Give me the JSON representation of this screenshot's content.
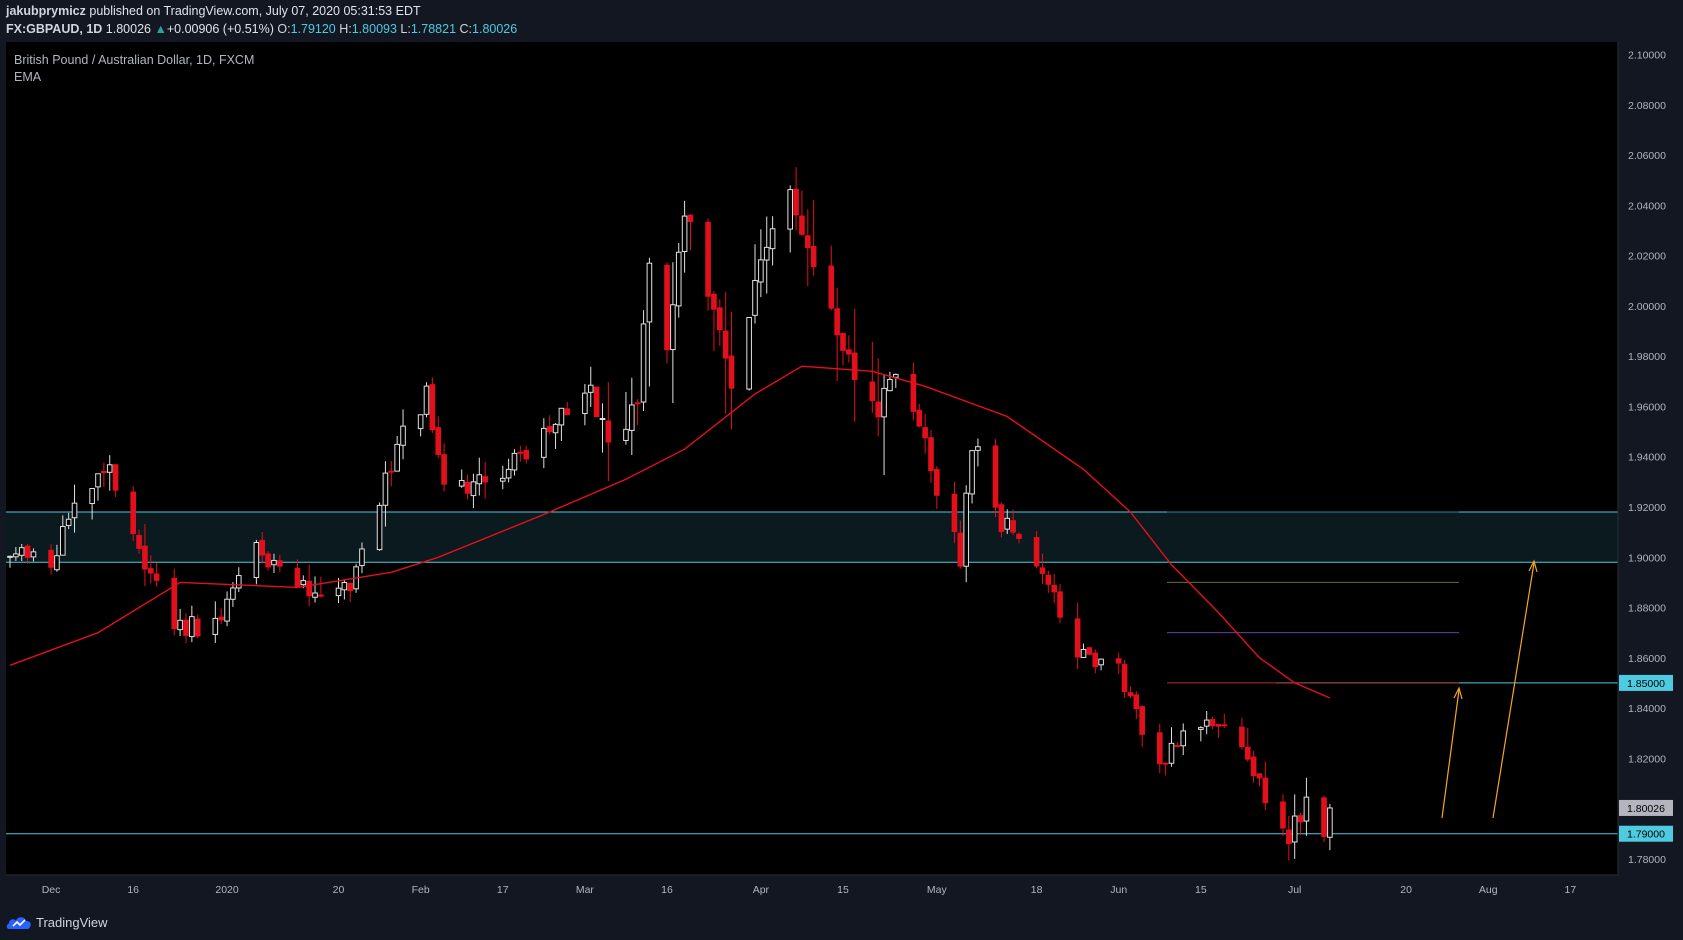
{
  "header": {
    "author": "jakubprymicz",
    "published_text": "published on TradingView.com, July 07, 2020 05:31:53 EDT",
    "symbol": "FX:GBPAUD, 1D",
    "last_price": "1.80026",
    "change": "+0.00906 (+0.51%)",
    "open_label": "O:",
    "open": "1.79120",
    "high_label": "H:",
    "high": "1.80093",
    "low_label": "L:",
    "low": "1.78821",
    "close_label": "C:",
    "close": "1.80026"
  },
  "legend": {
    "title": "British Pound / Australian Dollar, 1D, FXCM",
    "indicator": "EMA"
  },
  "footer": {
    "logo_text": "TradingView"
  },
  "colors": {
    "background": "#000000",
    "up_candle": "#e0e0e0",
    "down_candle": "#e3101c",
    "ema": "#e3101c",
    "support_line": "#4ecbe0",
    "zone_fill": "#0a1a1e",
    "arrow": "#f5a623",
    "level_olive": "#6b6b2a",
    "level_purple": "#6a3fa0",
    "level_red": "#b0302a",
    "current_price_tag": "#b2b5be"
  },
  "chart_data": {
    "type": "candlestick",
    "title": "British Pound / Australian Dollar, 1D, FXCM",
    "symbol": "FX:GBPAUD",
    "interval": "1D",
    "x_start": "2019-11-25",
    "x_end": "2020-08-20",
    "last_bar_date": "2020-07-07",
    "ylim": [
      1.77,
      2.105
    ],
    "y_ticks": [
      "2.10000",
      "2.08000",
      "2.06000",
      "2.04000",
      "2.02000",
      "2.00000",
      "1.98000",
      "1.96000",
      "1.94000",
      "1.92000",
      "1.90000",
      "1.88000",
      "1.86000",
      "1.84000",
      "1.82000",
      "1.80000",
      "1.78000"
    ],
    "x_ticks": [
      {
        "label": "Dec",
        "date": "2019-12-02"
      },
      {
        "label": "16",
        "date": "2019-12-16"
      },
      {
        "label": "2020",
        "date": "2020-01-01"
      },
      {
        "label": "20",
        "date": "2020-01-20"
      },
      {
        "label": "Feb",
        "date": "2020-02-03"
      },
      {
        "label": "17",
        "date": "2020-02-17"
      },
      {
        "label": "Mar",
        "date": "2020-03-02"
      },
      {
        "label": "16",
        "date": "2020-03-16"
      },
      {
        "label": "Apr",
        "date": "2020-04-01"
      },
      {
        "label": "15",
        "date": "2020-04-15"
      },
      {
        "label": "May",
        "date": "2020-05-01"
      },
      {
        "label": "18",
        "date": "2020-05-18"
      },
      {
        "label": "Jun",
        "date": "2020-06-01"
      },
      {
        "label": "15",
        "date": "2020-06-15"
      },
      {
        "label": "Jul",
        "date": "2020-07-01"
      },
      {
        "label": "20",
        "date": "2020-07-20"
      },
      {
        "label": "Aug",
        "date": "2020-08-03"
      },
      {
        "label": "17",
        "date": "2020-08-17"
      }
    ],
    "price_path": [
      {
        "date": "2019-11-25",
        "price": 1.901
      },
      {
        "date": "2019-12-03",
        "price": 1.902
      },
      {
        "date": "2019-12-10",
        "price": 1.935
      },
      {
        "date": "2019-12-13",
        "price": 1.93
      },
      {
        "date": "2019-12-17",
        "price": 1.905
      },
      {
        "date": "2019-12-24",
        "price": 1.871
      },
      {
        "date": "2019-12-31",
        "price": 1.879
      },
      {
        "date": "2020-01-06",
        "price": 1.905
      },
      {
        "date": "2020-01-13",
        "price": 1.885
      },
      {
        "date": "2020-01-22",
        "price": 1.885
      },
      {
        "date": "2020-01-28",
        "price": 1.93
      },
      {
        "date": "2020-02-04",
        "price": 1.968
      },
      {
        "date": "2020-02-07",
        "price": 1.93
      },
      {
        "date": "2020-02-13",
        "price": 1.93
      },
      {
        "date": "2020-02-18",
        "price": 1.935
      },
      {
        "date": "2020-02-26",
        "price": 1.958
      },
      {
        "date": "2020-03-03",
        "price": 1.97
      },
      {
        "date": "2020-03-06",
        "price": 1.94
      },
      {
        "date": "2020-03-11",
        "price": 1.96
      },
      {
        "date": "2020-03-13",
        "price": 2.02
      },
      {
        "date": "2020-03-16",
        "price": 1.982
      },
      {
        "date": "2020-03-19",
        "price": 2.04
      },
      {
        "date": "2020-03-24",
        "price": 2.0
      },
      {
        "date": "2020-03-27",
        "price": 1.965
      },
      {
        "date": "2020-04-01",
        "price": 2.02
      },
      {
        "date": "2020-04-06",
        "price": 2.05
      },
      {
        "date": "2020-04-08",
        "price": 2.03
      },
      {
        "date": "2020-04-15",
        "price": 1.98
      },
      {
        "date": "2020-04-21",
        "price": 1.96
      },
      {
        "date": "2020-04-24",
        "price": 1.975
      },
      {
        "date": "2020-04-30",
        "price": 1.935
      },
      {
        "date": "2020-05-05",
        "price": 1.9
      },
      {
        "date": "2020-05-07",
        "price": 1.945
      },
      {
        "date": "2020-05-13",
        "price": 1.91
      },
      {
        "date": "2020-05-19",
        "price": 1.895
      },
      {
        "date": "2020-05-26",
        "price": 1.86
      },
      {
        "date": "2020-06-01",
        "price": 1.855
      },
      {
        "date": "2020-06-08",
        "price": 1.82
      },
      {
        "date": "2020-06-12",
        "price": 1.83
      },
      {
        "date": "2020-06-16",
        "price": 1.838
      },
      {
        "date": "2020-06-22",
        "price": 1.822
      },
      {
        "date": "2020-06-26",
        "price": 1.805
      },
      {
        "date": "2020-06-30",
        "price": 1.79
      },
      {
        "date": "2020-07-03",
        "price": 1.805
      },
      {
        "date": "2020-07-06",
        "price": 1.792
      },
      {
        "date": "2020-07-07",
        "price": 1.80026
      }
    ],
    "ema": [
      {
        "date": "2019-11-25",
        "price": 1.857
      },
      {
        "date": "2019-12-10",
        "price": 1.87
      },
      {
        "date": "2019-12-24",
        "price": 1.89
      },
      {
        "date": "2020-01-13",
        "price": 1.888
      },
      {
        "date": "2020-01-29",
        "price": 1.894
      },
      {
        "date": "2020-02-06",
        "price": 1.9
      },
      {
        "date": "2020-02-24",
        "price": 1.917
      },
      {
        "date": "2020-03-09",
        "price": 1.931
      },
      {
        "date": "2020-03-19",
        "price": 1.943
      },
      {
        "date": "2020-03-31",
        "price": 1.965
      },
      {
        "date": "2020-04-08",
        "price": 1.976
      },
      {
        "date": "2020-04-20",
        "price": 1.974
      },
      {
        "date": "2020-04-29",
        "price": 1.968
      },
      {
        "date": "2020-05-13",
        "price": 1.956
      },
      {
        "date": "2020-05-26",
        "price": 1.935
      },
      {
        "date": "2020-06-03",
        "price": 1.918
      },
      {
        "date": "2020-06-10",
        "price": 1.897
      },
      {
        "date": "2020-06-18",
        "price": 1.878
      },
      {
        "date": "2020-06-25",
        "price": 1.86
      },
      {
        "date": "2020-07-01",
        "price": 1.85
      },
      {
        "date": "2020-07-07",
        "price": 1.844
      }
    ],
    "price_levels": [
      {
        "price": 1.85,
        "label": "1.85000"
      },
      {
        "price": 1.79,
        "label": "1.79000"
      }
    ],
    "current_price": {
      "price": 1.80026,
      "label": "1.80026"
    },
    "zone": {
      "from": 1.898,
      "to": 1.918
    }
  }
}
